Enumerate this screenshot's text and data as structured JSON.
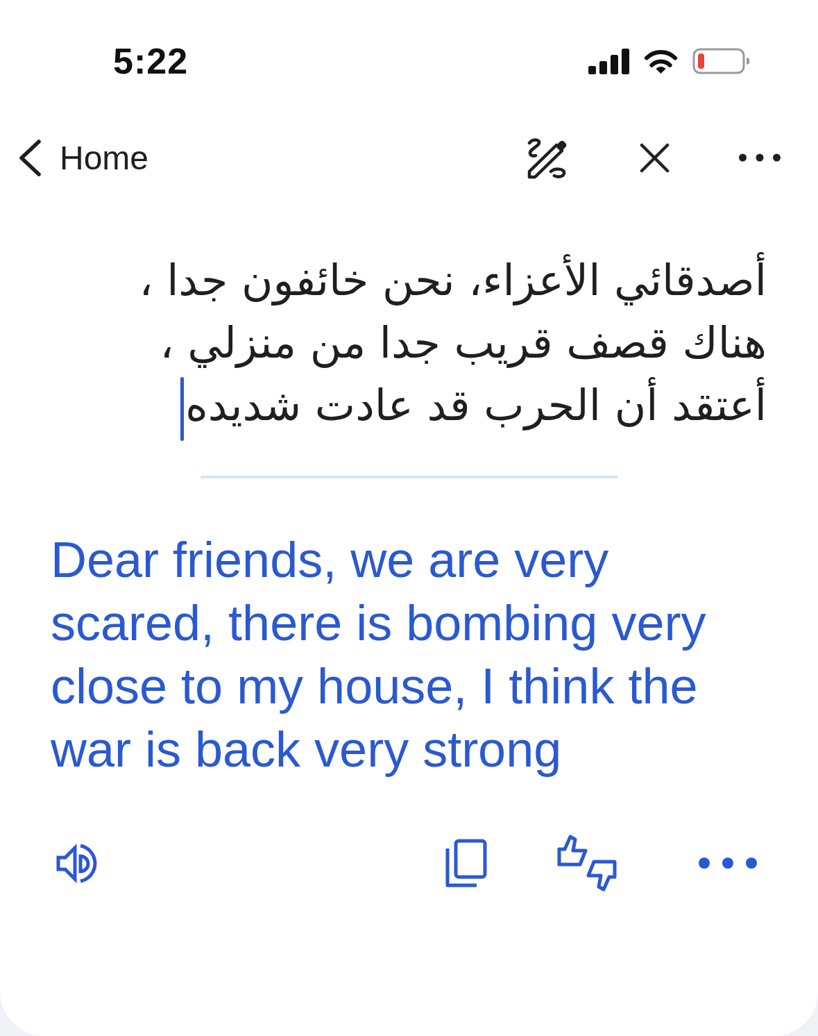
{
  "status_bar": {
    "time": "5:22"
  },
  "nav": {
    "back_label": "Home"
  },
  "source": {
    "text": "أصدقائي الأعزاء، نحن خائفون جدا ، هناك قصف قريب جدا من منزلي ، أعتقد أن الحرب قد عادت شديده",
    "focused": true
  },
  "translation": {
    "text": "Dear friends, we are very scared, there is bombing very close to my house, I think the war is back very strong"
  }
}
